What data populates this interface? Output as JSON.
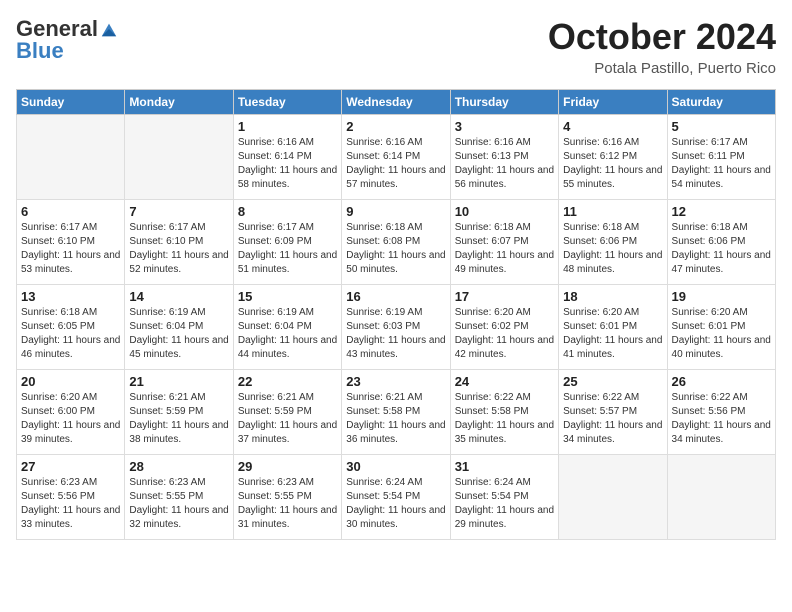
{
  "header": {
    "logo_general": "General",
    "logo_blue": "Blue",
    "month_title": "October 2024",
    "location": "Potala Pastillo, Puerto Rico"
  },
  "weekdays": [
    "Sunday",
    "Monday",
    "Tuesday",
    "Wednesday",
    "Thursday",
    "Friday",
    "Saturday"
  ],
  "weeks": [
    [
      {
        "day": "",
        "info": ""
      },
      {
        "day": "",
        "info": ""
      },
      {
        "day": "1",
        "info": "Sunrise: 6:16 AM\nSunset: 6:14 PM\nDaylight: 11 hours and 58 minutes."
      },
      {
        "day": "2",
        "info": "Sunrise: 6:16 AM\nSunset: 6:14 PM\nDaylight: 11 hours and 57 minutes."
      },
      {
        "day": "3",
        "info": "Sunrise: 6:16 AM\nSunset: 6:13 PM\nDaylight: 11 hours and 56 minutes."
      },
      {
        "day": "4",
        "info": "Sunrise: 6:16 AM\nSunset: 6:12 PM\nDaylight: 11 hours and 55 minutes."
      },
      {
        "day": "5",
        "info": "Sunrise: 6:17 AM\nSunset: 6:11 PM\nDaylight: 11 hours and 54 minutes."
      }
    ],
    [
      {
        "day": "6",
        "info": "Sunrise: 6:17 AM\nSunset: 6:10 PM\nDaylight: 11 hours and 53 minutes."
      },
      {
        "day": "7",
        "info": "Sunrise: 6:17 AM\nSunset: 6:10 PM\nDaylight: 11 hours and 52 minutes."
      },
      {
        "day": "8",
        "info": "Sunrise: 6:17 AM\nSunset: 6:09 PM\nDaylight: 11 hours and 51 minutes."
      },
      {
        "day": "9",
        "info": "Sunrise: 6:18 AM\nSunset: 6:08 PM\nDaylight: 11 hours and 50 minutes."
      },
      {
        "day": "10",
        "info": "Sunrise: 6:18 AM\nSunset: 6:07 PM\nDaylight: 11 hours and 49 minutes."
      },
      {
        "day": "11",
        "info": "Sunrise: 6:18 AM\nSunset: 6:06 PM\nDaylight: 11 hours and 48 minutes."
      },
      {
        "day": "12",
        "info": "Sunrise: 6:18 AM\nSunset: 6:06 PM\nDaylight: 11 hours and 47 minutes."
      }
    ],
    [
      {
        "day": "13",
        "info": "Sunrise: 6:18 AM\nSunset: 6:05 PM\nDaylight: 11 hours and 46 minutes."
      },
      {
        "day": "14",
        "info": "Sunrise: 6:19 AM\nSunset: 6:04 PM\nDaylight: 11 hours and 45 minutes."
      },
      {
        "day": "15",
        "info": "Sunrise: 6:19 AM\nSunset: 6:04 PM\nDaylight: 11 hours and 44 minutes."
      },
      {
        "day": "16",
        "info": "Sunrise: 6:19 AM\nSunset: 6:03 PM\nDaylight: 11 hours and 43 minutes."
      },
      {
        "day": "17",
        "info": "Sunrise: 6:20 AM\nSunset: 6:02 PM\nDaylight: 11 hours and 42 minutes."
      },
      {
        "day": "18",
        "info": "Sunrise: 6:20 AM\nSunset: 6:01 PM\nDaylight: 11 hours and 41 minutes."
      },
      {
        "day": "19",
        "info": "Sunrise: 6:20 AM\nSunset: 6:01 PM\nDaylight: 11 hours and 40 minutes."
      }
    ],
    [
      {
        "day": "20",
        "info": "Sunrise: 6:20 AM\nSunset: 6:00 PM\nDaylight: 11 hours and 39 minutes."
      },
      {
        "day": "21",
        "info": "Sunrise: 6:21 AM\nSunset: 5:59 PM\nDaylight: 11 hours and 38 minutes."
      },
      {
        "day": "22",
        "info": "Sunrise: 6:21 AM\nSunset: 5:59 PM\nDaylight: 11 hours and 37 minutes."
      },
      {
        "day": "23",
        "info": "Sunrise: 6:21 AM\nSunset: 5:58 PM\nDaylight: 11 hours and 36 minutes."
      },
      {
        "day": "24",
        "info": "Sunrise: 6:22 AM\nSunset: 5:58 PM\nDaylight: 11 hours and 35 minutes."
      },
      {
        "day": "25",
        "info": "Sunrise: 6:22 AM\nSunset: 5:57 PM\nDaylight: 11 hours and 34 minutes."
      },
      {
        "day": "26",
        "info": "Sunrise: 6:22 AM\nSunset: 5:56 PM\nDaylight: 11 hours and 34 minutes."
      }
    ],
    [
      {
        "day": "27",
        "info": "Sunrise: 6:23 AM\nSunset: 5:56 PM\nDaylight: 11 hours and 33 minutes."
      },
      {
        "day": "28",
        "info": "Sunrise: 6:23 AM\nSunset: 5:55 PM\nDaylight: 11 hours and 32 minutes."
      },
      {
        "day": "29",
        "info": "Sunrise: 6:23 AM\nSunset: 5:55 PM\nDaylight: 11 hours and 31 minutes."
      },
      {
        "day": "30",
        "info": "Sunrise: 6:24 AM\nSunset: 5:54 PM\nDaylight: 11 hours and 30 minutes."
      },
      {
        "day": "31",
        "info": "Sunrise: 6:24 AM\nSunset: 5:54 PM\nDaylight: 11 hours and 29 minutes."
      },
      {
        "day": "",
        "info": ""
      },
      {
        "day": "",
        "info": ""
      }
    ]
  ]
}
